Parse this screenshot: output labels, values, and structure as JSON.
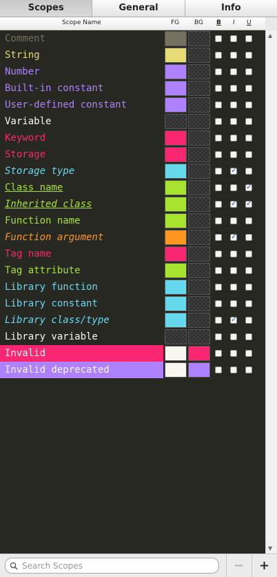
{
  "tabs": [
    {
      "label": "Scopes",
      "active": true
    },
    {
      "label": "General",
      "active": false
    },
    {
      "label": "Info",
      "active": false
    }
  ],
  "columns": {
    "name": "Scope Name",
    "fg": "FG",
    "bg": "BG",
    "bold": "B",
    "italic": "I",
    "underline": "U"
  },
  "rows": [
    {
      "label": "Comment",
      "color": "#75715e",
      "fg": "#75715e",
      "bg": null,
      "bold": false,
      "italic": false,
      "underline": false
    },
    {
      "label": "String",
      "color": "#e6db74",
      "fg": "#e6db74",
      "bg": null,
      "bold": false,
      "italic": false,
      "underline": false
    },
    {
      "label": "Number",
      "color": "#ae81ff",
      "fg": "#ae81ff",
      "bg": null,
      "bold": false,
      "italic": false,
      "underline": false
    },
    {
      "label": "Built-in constant",
      "color": "#ae81ff",
      "fg": "#ae81ff",
      "bg": null,
      "bold": false,
      "italic": false,
      "underline": false
    },
    {
      "label": "User-defined constant",
      "color": "#ae81ff",
      "fg": "#ae81ff",
      "bg": null,
      "bold": false,
      "italic": false,
      "underline": false
    },
    {
      "label": "Variable",
      "color": "#f8f8f2",
      "fg": null,
      "bg": null,
      "bold": false,
      "italic": false,
      "underline": false
    },
    {
      "label": "Keyword",
      "color": "#f92672",
      "fg": "#f92672",
      "bg": null,
      "bold": false,
      "italic": false,
      "underline": false
    },
    {
      "label": "Storage",
      "color": "#f92672",
      "fg": "#f92672",
      "bg": null,
      "bold": false,
      "italic": false,
      "underline": false
    },
    {
      "label": "Storage type",
      "color": "#66d9ef",
      "fg": "#66d9ef",
      "bg": null,
      "bold": false,
      "italic": true,
      "underline": false
    },
    {
      "label": "Class name",
      "color": "#a6e22e",
      "fg": "#a6e22e",
      "bg": null,
      "bold": false,
      "italic": false,
      "underline": true
    },
    {
      "label": "Inherited class",
      "color": "#a6e22e",
      "fg": "#a6e22e",
      "bg": null,
      "bold": false,
      "italic": true,
      "underline": true
    },
    {
      "label": "Function name",
      "color": "#a6e22e",
      "fg": "#a6e22e",
      "bg": null,
      "bold": false,
      "italic": false,
      "underline": false
    },
    {
      "label": "Function argument",
      "color": "#fd971f",
      "fg": "#fd971f",
      "bg": null,
      "bold": false,
      "italic": true,
      "underline": false
    },
    {
      "label": "Tag name",
      "color": "#f92672",
      "fg": "#f92672",
      "bg": null,
      "bold": false,
      "italic": false,
      "underline": false
    },
    {
      "label": "Tag attribute",
      "color": "#a6e22e",
      "fg": "#a6e22e",
      "bg": null,
      "bold": false,
      "italic": false,
      "underline": false
    },
    {
      "label": "Library function",
      "color": "#66d9ef",
      "fg": "#66d9ef",
      "bg": null,
      "bold": false,
      "italic": false,
      "underline": false
    },
    {
      "label": "Library constant",
      "color": "#66d9ef",
      "fg": "#66d9ef",
      "bg": null,
      "bold": false,
      "italic": false,
      "underline": false
    },
    {
      "label": "Library class/type",
      "color": "#66d9ef",
      "fg": "#66d9ef",
      "bg": null,
      "bold": false,
      "italic": true,
      "underline": false
    },
    {
      "label": "Library variable",
      "color": "#f8f8f2",
      "fg": null,
      "bg": null,
      "bold": false,
      "italic": false,
      "underline": false
    },
    {
      "label": "Invalid",
      "color": "#f8f8f0",
      "fg": "#f8f8f0",
      "bg": "#f92672",
      "bold": false,
      "italic": false,
      "underline": false
    },
    {
      "label": "Invalid deprecated",
      "color": "#f8f8f0",
      "fg": "#f8f8f0",
      "bg": "#ae81ff",
      "bold": false,
      "italic": false,
      "underline": false
    }
  ],
  "search": {
    "placeholder": "Search Scopes",
    "value": ""
  },
  "buttons": {
    "remove": "−",
    "add": "+"
  },
  "icons": {
    "search": "search-icon",
    "scroll_up": "scroll-up-arrow-icon",
    "scroll_down": "scroll-down-arrow-icon"
  }
}
